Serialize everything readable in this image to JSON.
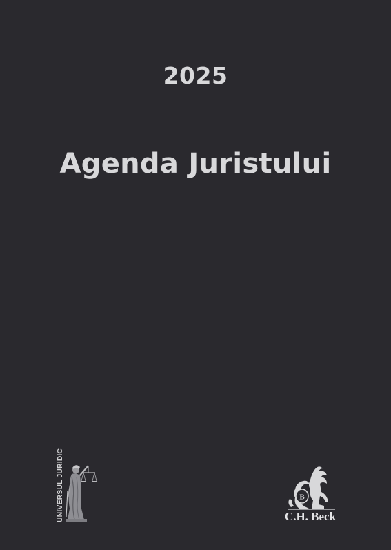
{
  "cover": {
    "year": "2025",
    "title": "Agenda Juristului"
  },
  "publishers": {
    "left": {
      "name": "UNIVERSUL JURIDIC",
      "icon": "justice-statue-icon"
    },
    "right": {
      "name": "C.H. Beck",
      "emblem_letter": "B",
      "icon": "griffin-emblem-icon"
    }
  },
  "colors": {
    "background": "#2a292e",
    "text": "#d8d8da"
  }
}
